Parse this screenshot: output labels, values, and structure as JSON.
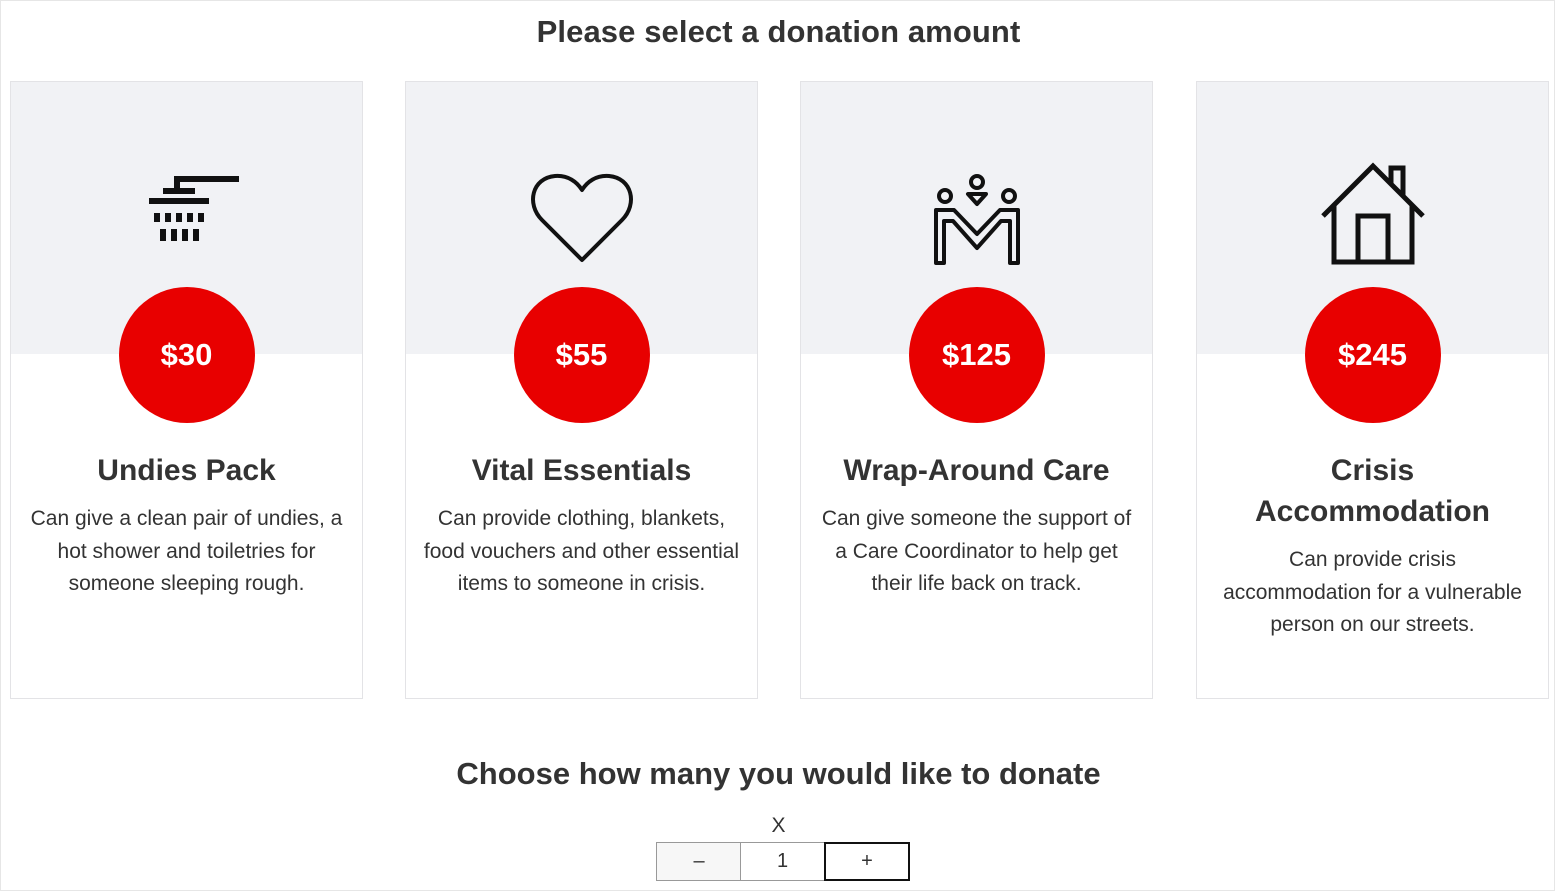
{
  "page": {
    "title": "Please select a donation amount",
    "subtitle": "Choose how many you would like to donate"
  },
  "cards": [
    {
      "icon": "shower-icon",
      "price": "$30",
      "title": "Undies Pack",
      "description": "Can give a clean pair of undies, a hot shower and toiletries for someone sleeping rough."
    },
    {
      "icon": "heart-icon",
      "price": "$55",
      "title": "Vital Essentials",
      "description": "Can provide clothing, blankets, food vouchers and other essential items to someone in crisis."
    },
    {
      "icon": "people-support-icon",
      "price": "$125",
      "title": "Wrap-Around Care",
      "description": "Can give someone the support of a Care Coordinator to help get their life back on track."
    },
    {
      "icon": "house-icon",
      "price": "$245",
      "title": "Crisis Accommodation",
      "description": "Can provide crisis accommodation for a vulnerable person on our streets."
    }
  ],
  "quantity": {
    "label": "X",
    "minus_label": "–",
    "value": "1",
    "plus_label": "+"
  },
  "colors": {
    "accent": "#e80000",
    "card_top": "#f1f2f5",
    "text": "#333333"
  }
}
